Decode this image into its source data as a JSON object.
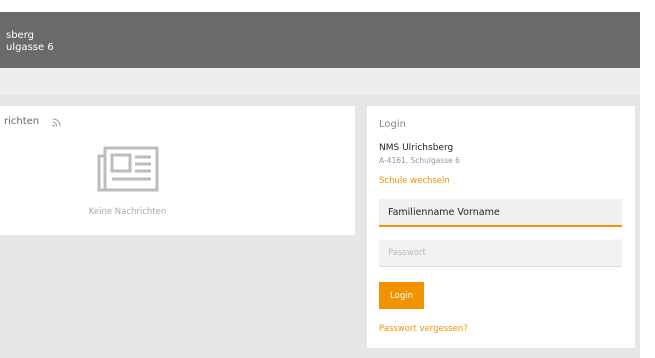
{
  "header": {
    "line1": "sberg",
    "line2": "ulgasse 6"
  },
  "news": {
    "title": "richten",
    "empty_text": "Keine Nachrichten",
    "feed_icon": "rss-icon",
    "placeholder_icon": "newspaper-icon"
  },
  "login": {
    "title": "Login",
    "school_name": "NMS Ulrichsberg",
    "school_address": "A-4161, Schulgasse 6",
    "switch_school": "Schule wechseln",
    "username_value": "Familienname Vorname",
    "password_placeholder": "Passwort",
    "button_label": "Login",
    "forgot_link": "Passwort vergessen?"
  },
  "colors": {
    "accent": "#f39200",
    "header_bg": "#6a6a6a",
    "page_bg": "#e6e6e6"
  }
}
